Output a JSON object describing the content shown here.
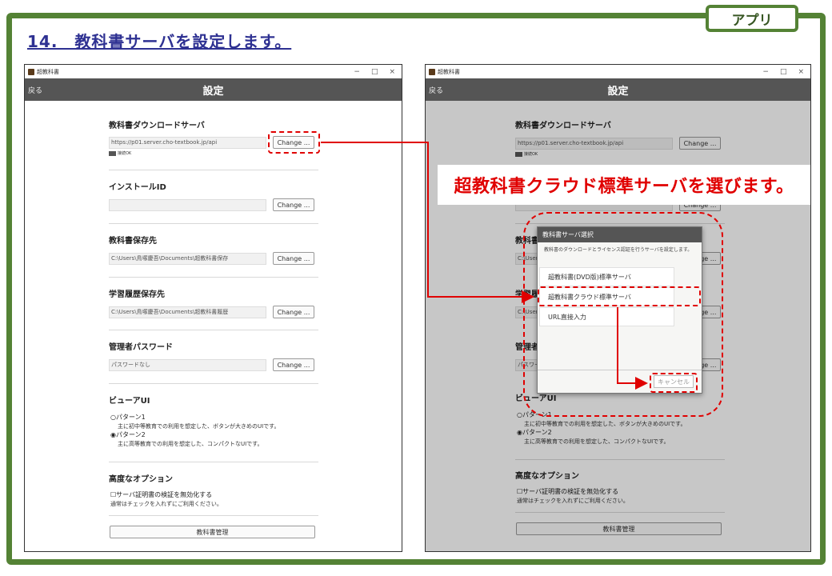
{
  "slide": {
    "tag": "アプリ",
    "title": "14.　教科書サーバを設定します。",
    "callout": "超教科書クラウド標準サーバを選びます。"
  },
  "window": {
    "app_title": "超教科書",
    "controls": [
      "−",
      "□",
      "×"
    ],
    "back_label": "戻る",
    "page_title": "設定"
  },
  "settings": {
    "download_server": {
      "title": "教科書ダウンロードサーバ",
      "value": "https://p01.server.cho-textbook.jp/api",
      "button": "Change ...",
      "status": "接続OK"
    },
    "install_id": {
      "title": "インストールID",
      "value": "",
      "button": "Change ..."
    },
    "textbook_dir": {
      "title": "教科書保存先",
      "value": "C:\\Users\\鳥塚慶吾\\Documents\\超教科書保存",
      "button": "Change ..."
    },
    "history_dir": {
      "title": "学習履歴保存先",
      "value": "C:\\Users\\鳥塚慶吾\\Documents\\超教科書履歴",
      "button": "Change ..."
    },
    "admin_password": {
      "title": "管理者パスワード",
      "value": "パスワードなし",
      "button": "Change ..."
    },
    "viewer_ui": {
      "title": "ビューアUI",
      "pattern1_label": "○パターン1",
      "pattern1_desc": "主に初中等教育での利用を想定した、ボタンが大きめのUIです。",
      "pattern2_label": "◉パターン2",
      "pattern2_desc": "主に高等教育での利用を想定した、コンパクトなUIです。"
    },
    "advanced": {
      "title": "高度なオプション",
      "cert_label": "☐サーバ証明書の検証を無効化する",
      "cert_note": "通常はチェックを入れずにご利用ください。"
    },
    "manage_button": "教科書管理"
  },
  "dialog": {
    "title": "教科書サーバ選択",
    "description": "教科書のダウンロードとライセンス認証を行うサーバを設定します。",
    "options": [
      "超教科書(DVD版)標準サーバ",
      "超教科書クラウド標準サーバ",
      "URL直接入力"
    ],
    "cancel": "キャンセル"
  },
  "colors": {
    "frame_green": "#548235",
    "title_blue": "#2e3192",
    "highlight_red": "#e00000",
    "navbar_gray": "#555555"
  }
}
